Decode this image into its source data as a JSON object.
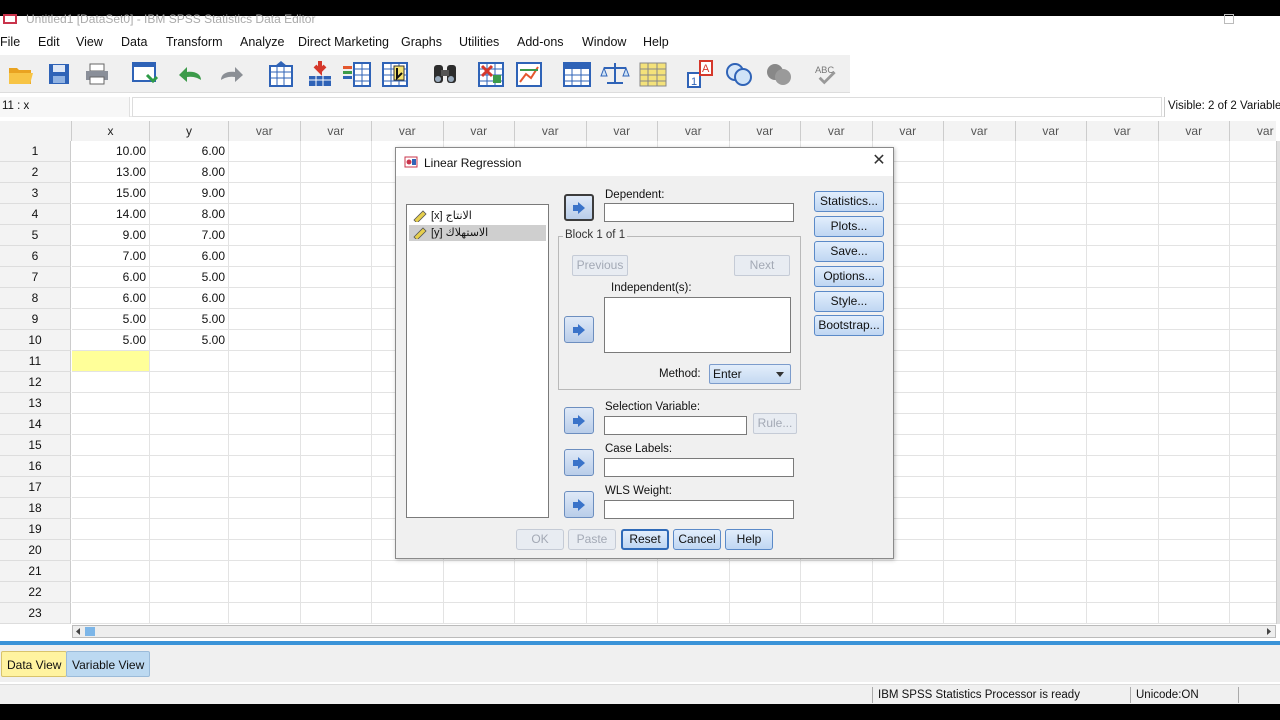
{
  "window": {
    "title": "Untitled1 [DataSet0] - IBM SPSS Statistics Data Editor"
  },
  "menu": [
    "File",
    "Edit",
    "View",
    "Data",
    "Transform",
    "Analyze",
    "Direct Marketing",
    "Graphs",
    "Utilities",
    "Add-ons",
    "Window",
    "Help"
  ],
  "toolbar_icons": [
    "open-icon",
    "save-icon",
    "print-icon",
    "recall-dialog-icon",
    "undo-icon",
    "redo-icon",
    "goto-case-icon",
    "goto-variable-icon",
    "variables-icon",
    "run-descriptives-icon",
    "find-icon",
    "insert-cases-icon",
    "insert-variable-icon",
    "split-file-icon",
    "weight-cases-icon",
    "select-cases-icon",
    "value-labels-icon",
    "use-sets-icon",
    "show-all-variables-icon",
    "spelling-icon"
  ],
  "cellbar": {
    "ref": "11 : x",
    "value": "",
    "visible": "Visible: 2 of 2 Variables"
  },
  "grid": {
    "columns": [
      "x",
      "y",
      "var",
      "var",
      "var",
      "var",
      "var",
      "var",
      "var",
      "var",
      "var",
      "var",
      "var",
      "var",
      "var",
      "var",
      "var"
    ],
    "rows": [
      "1",
      "2",
      "3",
      "4",
      "5",
      "6",
      "7",
      "8",
      "9",
      "10",
      "11",
      "12",
      "13",
      "14",
      "15",
      "16",
      "17",
      "18",
      "19",
      "20",
      "21",
      "22",
      "23"
    ],
    "data": [
      [
        "10.00",
        "6.00"
      ],
      [
        "13.00",
        "8.00"
      ],
      [
        "15.00",
        "9.00"
      ],
      [
        "14.00",
        "8.00"
      ],
      [
        "9.00",
        "7.00"
      ],
      [
        "7.00",
        "6.00"
      ],
      [
        "6.00",
        "5.00"
      ],
      [
        "6.00",
        "6.00"
      ],
      [
        "5.00",
        "5.00"
      ],
      [
        "5.00",
        "5.00"
      ]
    ],
    "active_row": 11
  },
  "tabs": {
    "data_view": "Data View",
    "variable_view": "Variable View"
  },
  "status": {
    "processor": "IBM SPSS Statistics Processor is ready",
    "unicode": "Unicode:ON"
  },
  "dialog": {
    "title": "Linear Regression",
    "variables": [
      "[x] الانتاج",
      "[y] الاستهلاك"
    ],
    "dependent_label": "Dependent:",
    "block_label": "Block 1 of 1",
    "previous": "Previous",
    "next": "Next",
    "independents_label": "Independent(s):",
    "method_label": "Method:",
    "method_value": "Enter",
    "selection_label": "Selection Variable:",
    "rule": "Rule...",
    "case_labels_label": "Case Labels:",
    "wls_label": "WLS Weight:",
    "side_buttons": [
      "Statistics...",
      "Plots...",
      "Save...",
      "Options...",
      "Style...",
      "Bootstrap..."
    ],
    "bottom_buttons": [
      "OK",
      "Paste",
      "Reset",
      "Cancel",
      "Help"
    ]
  }
}
